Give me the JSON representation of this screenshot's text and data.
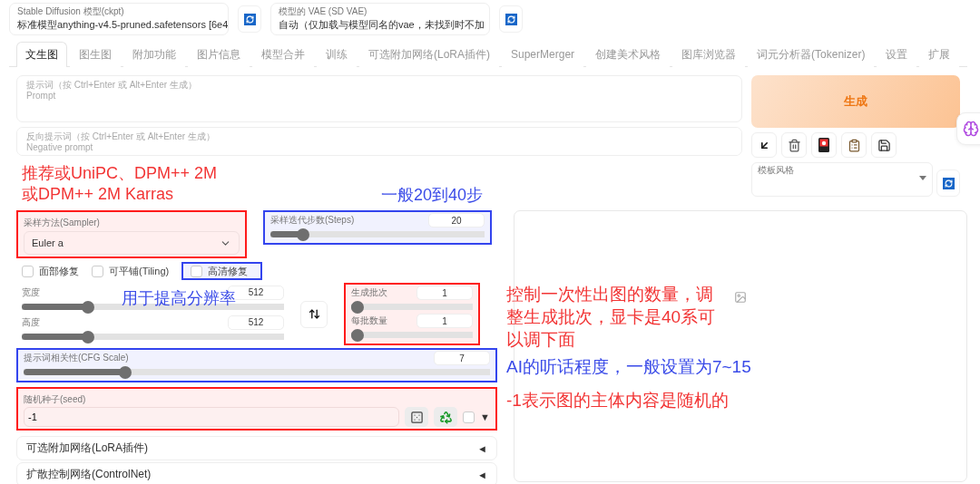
{
  "top_bar": {
    "checkpoint": {
      "label": "Stable Diffusion 模型(ckpt)",
      "value": "标准模型anything-v4.5-pruned.safetensors [6e4"
    },
    "vae": {
      "label": "模型的 VAE (SD VAE)",
      "value": "自动（仅加载与模型同名的vae，未找到时不加"
    }
  },
  "tabs": [
    {
      "label": "文生图",
      "selected": true
    },
    {
      "label": "图生图",
      "selected": false
    },
    {
      "label": "附加功能",
      "selected": false
    },
    {
      "label": "图片信息",
      "selected": false
    },
    {
      "label": "模型合并",
      "selected": false
    },
    {
      "label": "训练",
      "selected": false
    },
    {
      "label": "可选附加网络(LoRA插件)",
      "selected": false
    },
    {
      "label": "SuperMerger",
      "selected": false
    },
    {
      "label": "创建美术风格",
      "selected": false
    },
    {
      "label": "图库浏览器",
      "selected": false
    },
    {
      "label": "词元分析器(Tokenizer)",
      "selected": false
    },
    {
      "label": "设置",
      "selected": false
    },
    {
      "label": "扩展",
      "selected": false
    }
  ],
  "prompt": {
    "placeholder": "提示词（按 Ctrl+Enter 或 Alt+Enter 生成）\nPrompt"
  },
  "negative_prompt": {
    "placeholder": "反向提示词（按 Ctrl+Enter 或 Alt+Enter 生成）\nNegative prompt"
  },
  "generate_button": "生成",
  "style": {
    "label": "模板风格"
  },
  "sampler": {
    "label": "采样方法(Sampler)",
    "value": "Euler a"
  },
  "steps": {
    "label": "采样迭代步数(Steps)",
    "value": "20",
    "level": 0.13
  },
  "checkboxes": [
    {
      "label": "面部修复",
      "checked": false
    },
    {
      "label": "可平铺(Tiling)",
      "checked": false
    },
    {
      "label": "高清修复",
      "checked": false
    }
  ],
  "width": {
    "label": "宽度",
    "value": "512",
    "level": 0.24
  },
  "height": {
    "label": "高度",
    "value": "512",
    "level": 0.24
  },
  "batch": {
    "sliders": [
      {
        "label": "生成批次",
        "value": "1",
        "level": 0
      },
      {
        "label": "每批数量",
        "value": "1",
        "level": 0
      }
    ]
  },
  "cfg_scale": {
    "label": "提示词相关性(CFG Scale)",
    "value": "7",
    "level": 0.21
  },
  "seed": {
    "label": "随机种子(seed)",
    "value": "-1",
    "extra_checked": false,
    "toggle": "▼"
  },
  "accordions": [
    {
      "label": "可选附加网络(LoRA插件)",
      "toggle": "◄"
    },
    {
      "label": "扩散控制网络(ControlNet)",
      "toggle": "◄"
    }
  ],
  "annotations": [
    {
      "text": "推荐或UniPC、DPM++ 2M\n或DPM++ 2M Karras",
      "color": "#f23535"
    },
    {
      "text": "一般20到40步",
      "color": "#3a4be8"
    },
    {
      "text": "用于提高分辨率",
      "color": "#3a4be8"
    },
    {
      "text": "控制一次性出图的数量，调整生成批次，显卡是40系可以调下面",
      "color": "#f23535"
    },
    {
      "text": "AI的听话程度，一般设置为7~15",
      "color": "#3a4be8"
    },
    {
      "text": "-1表示图的主体内容是随机的",
      "color": "#f23535"
    }
  ]
}
